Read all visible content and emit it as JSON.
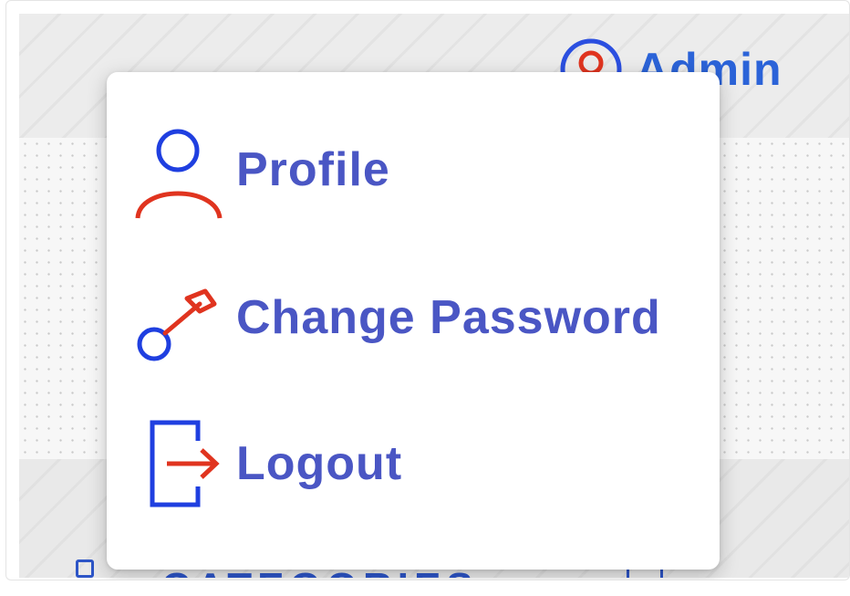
{
  "header": {
    "user_label": "Admin",
    "user_icon": "user-circle-icon"
  },
  "background": {
    "partial_text": "CATEGORIES"
  },
  "dropdown": {
    "items": [
      {
        "label": "Profile",
        "icon": "user-icon"
      },
      {
        "label": "Change Password",
        "icon": "key-icon"
      },
      {
        "label": "Logout",
        "icon": "logout-icon"
      }
    ]
  },
  "colors": {
    "menu_text": "#4a56c4",
    "icon_blue": "#1f3fe0",
    "icon_red": "#e0341f",
    "admin_text": "#2b63d8"
  }
}
